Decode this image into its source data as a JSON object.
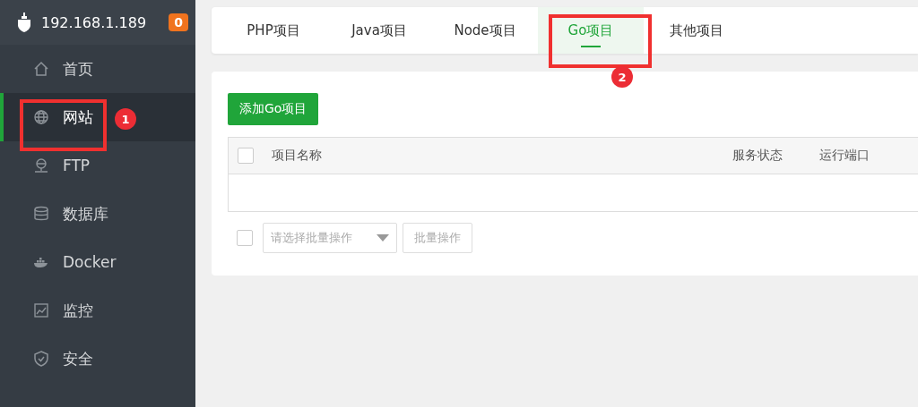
{
  "server": {
    "address": "192.168.1.189",
    "badge": "0"
  },
  "sidebar": {
    "items": [
      {
        "label": "首页",
        "selected": false
      },
      {
        "label": "网站",
        "selected": true
      },
      {
        "label": "FTP",
        "selected": false
      },
      {
        "label": "数据库",
        "selected": false
      },
      {
        "label": "Docker",
        "selected": false
      },
      {
        "label": "监控",
        "selected": false
      },
      {
        "label": "安全",
        "selected": false
      }
    ]
  },
  "tabs": [
    {
      "label": "PHP项目",
      "selected": false
    },
    {
      "label": "Java项目",
      "selected": false
    },
    {
      "label": "Node项目",
      "selected": false
    },
    {
      "label": "Go项目",
      "selected": true
    },
    {
      "label": "其他项目",
      "selected": false
    }
  ],
  "add_button": "添加Go项目",
  "table": {
    "columns": [
      "项目名称",
      "服务状态",
      "运行端口"
    ],
    "select_all_checked": false
  },
  "footer": {
    "checked": false,
    "batch_select_placeholder": "请选择批量操作",
    "batch_button": "批量操作"
  },
  "annotations": [
    "1",
    "2"
  ]
}
